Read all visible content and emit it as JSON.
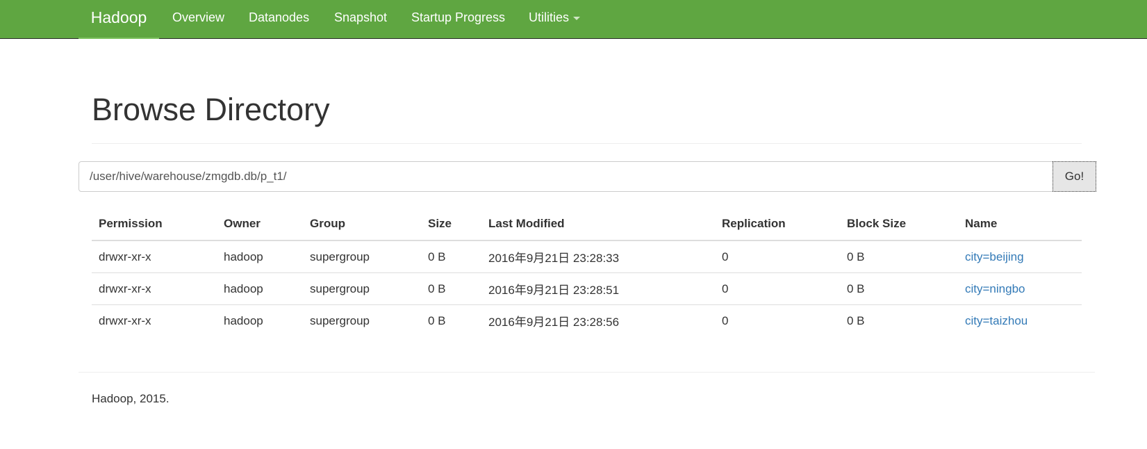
{
  "navbar": {
    "brand": "Hadoop",
    "items": [
      {
        "label": "Overview"
      },
      {
        "label": "Datanodes"
      },
      {
        "label": "Snapshot"
      },
      {
        "label": "Startup Progress"
      },
      {
        "label": "Utilities"
      }
    ],
    "color": "#5fa641"
  },
  "page": {
    "title": "Browse Directory"
  },
  "browse": {
    "path_value": "/user/hive/warehouse/zmgdb.db/p_t1/",
    "go_label": "Go!"
  },
  "table": {
    "headers": [
      "Permission",
      "Owner",
      "Group",
      "Size",
      "Last Modified",
      "Replication",
      "Block Size",
      "Name"
    ],
    "rows": [
      {
        "permission": "drwxr-xr-x",
        "owner": "hadoop",
        "group": "supergroup",
        "size": "0 B",
        "last_modified": "2016年9月21日 23:28:33",
        "replication": "0",
        "block_size": "0 B",
        "name": "city=beijing"
      },
      {
        "permission": "drwxr-xr-x",
        "owner": "hadoop",
        "group": "supergroup",
        "size": "0 B",
        "last_modified": "2016年9月21日 23:28:51",
        "replication": "0",
        "block_size": "0 B",
        "name": "city=ningbo"
      },
      {
        "permission": "drwxr-xr-x",
        "owner": "hadoop",
        "group": "supergroup",
        "size": "0 B",
        "last_modified": "2016年9月21日 23:28:56",
        "replication": "0",
        "block_size": "0 B",
        "name": "city=taizhou"
      }
    ],
    "link_color": "#337ab7"
  },
  "footer": {
    "text": "Hadoop, 2015."
  }
}
